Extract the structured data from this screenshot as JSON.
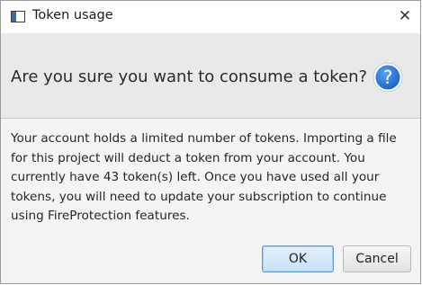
{
  "window": {
    "title": "Token usage",
    "close_glyph": "✕",
    "app_icon": "window-icon"
  },
  "header": {
    "question": "Are you sure you want to consume a token?",
    "icon": "question-icon",
    "icon_glyph": "?",
    "icon_color": "#1e6fd0"
  },
  "message": {
    "text": "Your account holds a limited number of tokens. Importing a file for this project will deduct a token from your account. You currently have 43 token(s) left. Once you have used all your tokens, you will need to update your subscription to continue using FireProtection features."
  },
  "buttons": {
    "ok_label": "OK",
    "cancel_label": "Cancel"
  }
}
